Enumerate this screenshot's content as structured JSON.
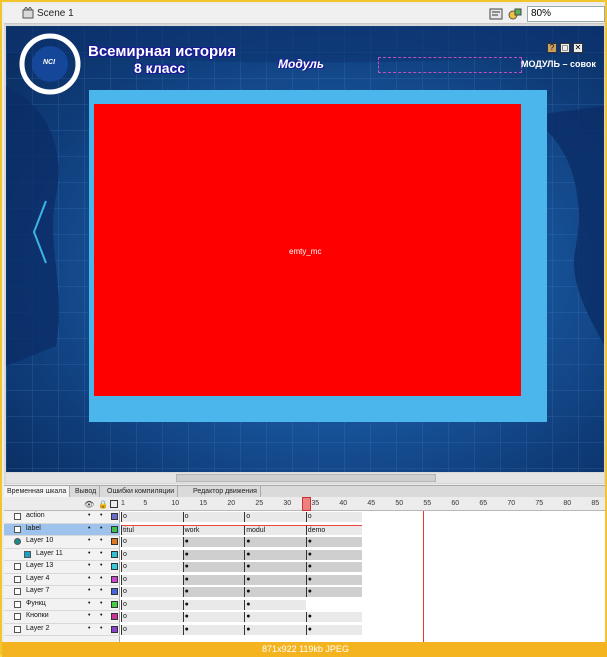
{
  "topbar": {
    "scene": "Scene 1",
    "zoom": "80%"
  },
  "stage": {
    "title_line1": "Всемирная история",
    "title_line2": "8 класс",
    "logo_text": "NCI",
    "modul_label": "Модуль",
    "modul_text": "МОДУЛЬ – совок",
    "content_clip": "emty_mc",
    "controls": [
      "?",
      "◻",
      "✕"
    ]
  },
  "panel": {
    "tabs": [
      "Временная шкала",
      "Вывод",
      "Ошибки компиляции",
      "Редактор движения"
    ],
    "ruler": [
      "1",
      "5",
      "10",
      "15",
      "20",
      "25",
      "30",
      "35",
      "40",
      "45",
      "50",
      "55",
      "60",
      "65",
      "70",
      "75",
      "80",
      "85"
    ],
    "layers": [
      {
        "name": "action",
        "swatch": "#6b6bd0",
        "selected": false,
        "type": "layer"
      },
      {
        "name": "label",
        "swatch": "#3fc04a",
        "selected": true,
        "type": "layer"
      },
      {
        "name": "Layer 10",
        "swatch": "#e07a1f",
        "selected": false,
        "type": "mask"
      },
      {
        "name": "Layer 11",
        "swatch": "#30c0d8",
        "selected": false,
        "type": "masked"
      },
      {
        "name": "Layer 13",
        "swatch": "#33ccdd",
        "selected": false,
        "type": "layer"
      },
      {
        "name": "Layer 4",
        "swatch": "#cc44cc",
        "selected": false,
        "type": "layer"
      },
      {
        "name": "Layer 7",
        "swatch": "#4466dd",
        "selected": false,
        "type": "layer"
      },
      {
        "name": "Функц",
        "swatch": "#44cc44",
        "selected": false,
        "type": "layer"
      },
      {
        "name": "Кнопки",
        "swatch": "#cc3399",
        "selected": false,
        "type": "layer"
      },
      {
        "name": "Layer 2",
        "swatch": "#8844cc",
        "selected": false,
        "type": "layer"
      }
    ],
    "frame_labels": [
      "titul",
      "work",
      "modul",
      "demo"
    ]
  },
  "status": "871x922  119kb  JPEG"
}
